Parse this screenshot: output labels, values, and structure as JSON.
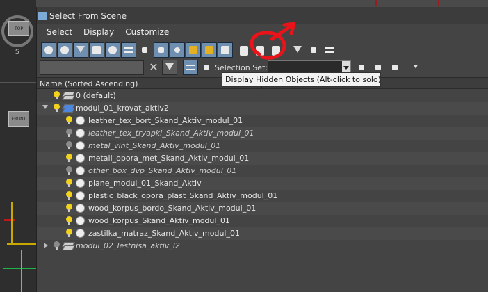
{
  "viewport": {
    "top_label": "TOP",
    "front_label": "FRONT",
    "compass_south": "S"
  },
  "dialog": {
    "title": "Select From Scene",
    "menu": [
      "Select",
      "Display",
      "Customize"
    ],
    "toolbar_icons": [
      "display-geometry-icon",
      "display-shapes-icon",
      "display-lights-icon",
      "display-cameras-icon",
      "display-helpers-icon",
      "display-spacewarps-icon",
      "display-groups-icon",
      "display-xrefs-icon",
      "display-bones-icon",
      "display-containers-icon",
      "display-frozen-icon",
      "display-hidden-icon",
      "display-all-icon",
      "display-none-icon",
      "invert-display-icon",
      "filter-icon",
      "sync-selection-icon",
      "column-options-icon"
    ],
    "selection_set_label": "Selection Set:",
    "tooltip": "Display Hidden Objects (Alt-click to solo)",
    "column_header": "Name (Sorted Ascending)",
    "tree": [
      {
        "label": "0 (default)",
        "type": "layer",
        "hidden": false,
        "bulb": "on",
        "level": 0
      },
      {
        "label": "modul_01_krovat_aktiv2",
        "type": "layer-active",
        "hidden": false,
        "bulb": "on",
        "level": 0,
        "expanded": true
      },
      {
        "label": "leather_tex_bort_Skand_Aktiv_modul_01",
        "type": "object",
        "hidden": false,
        "bulb": "on",
        "level": 1
      },
      {
        "label": "leather_tex_tryapki_Skand_Aktiv_modul_01",
        "type": "object",
        "hidden": true,
        "bulb": "off",
        "level": 1
      },
      {
        "label": "metal_vint_Skand_Aktiv_modul_01",
        "type": "object",
        "hidden": true,
        "bulb": "off",
        "level": 1
      },
      {
        "label": "metall_opora_met_Skand_Aktiv_modul_01",
        "type": "object",
        "hidden": false,
        "bulb": "on",
        "level": 1
      },
      {
        "label": "other_box_dvp_Skand_Aktiv_modul_01",
        "type": "object",
        "hidden": true,
        "bulb": "off",
        "level": 1
      },
      {
        "label": "plane_modul_01_Skand_Aktiv",
        "type": "object",
        "hidden": false,
        "bulb": "on",
        "level": 1
      },
      {
        "label": "plastic_black_opora_plast_Skand_Aktiv_modul_01",
        "type": "object",
        "hidden": false,
        "bulb": "on",
        "level": 1
      },
      {
        "label": "wood_korpus_bordo_Skand_Aktiv_modul_01",
        "type": "object",
        "hidden": false,
        "bulb": "on",
        "level": 1
      },
      {
        "label": "wood_korpus_Skand_Aktiv_modul_01",
        "type": "object",
        "hidden": false,
        "bulb": "on",
        "level": 1
      },
      {
        "label": "zastilka_matraz_Skand_Aktiv_modul_01",
        "type": "object",
        "hidden": false,
        "bulb": "on",
        "level": 1
      },
      {
        "label": "modul_02_lestnisa_aktiv_l2",
        "type": "layer",
        "hidden": true,
        "bulb": "off",
        "level": 0,
        "expanded": false
      }
    ]
  },
  "colors": {
    "annotation": "#e8141a",
    "highlight_button": "#6f8fb0"
  }
}
